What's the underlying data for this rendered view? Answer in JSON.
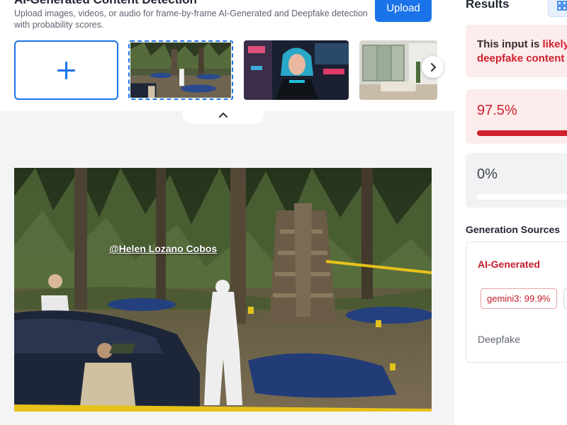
{
  "header": {
    "title": "AI-Generated Content Detection",
    "subtitle": "Upload images, videos, or audio for frame-by-frame AI-Generated and Deepfake detection with probability scores.",
    "upload_label": "Upload"
  },
  "icons": {
    "add": "plus-icon",
    "next": "chevron-right-icon",
    "collapse": "chevron-up-icon",
    "view_toggle": "grid-view-icon"
  },
  "main_image": {
    "watermark": "@Helen Lozano Cobos"
  },
  "results": {
    "title": "Results",
    "verdict_prefix": "This input is ",
    "verdict_highlight": "likely",
    "verdict_line2": "deepfake content",
    "ai_generated_score": "97.5%",
    "ai_generated_fraction": 0.975,
    "deepfake_score": "0%",
    "deepfake_fraction": 0.0,
    "generation_sources_title": "Generation Sources",
    "ai_generated_label": "AI-Generated",
    "model_chip": "gemini3: 99.9%",
    "deepfake_label": "Deepfake"
  },
  "colors": {
    "accent": "#1a73e8",
    "danger": "#d0202d",
    "danger_bg": "#fdecec",
    "neutral_bg": "#f1f2f4"
  }
}
